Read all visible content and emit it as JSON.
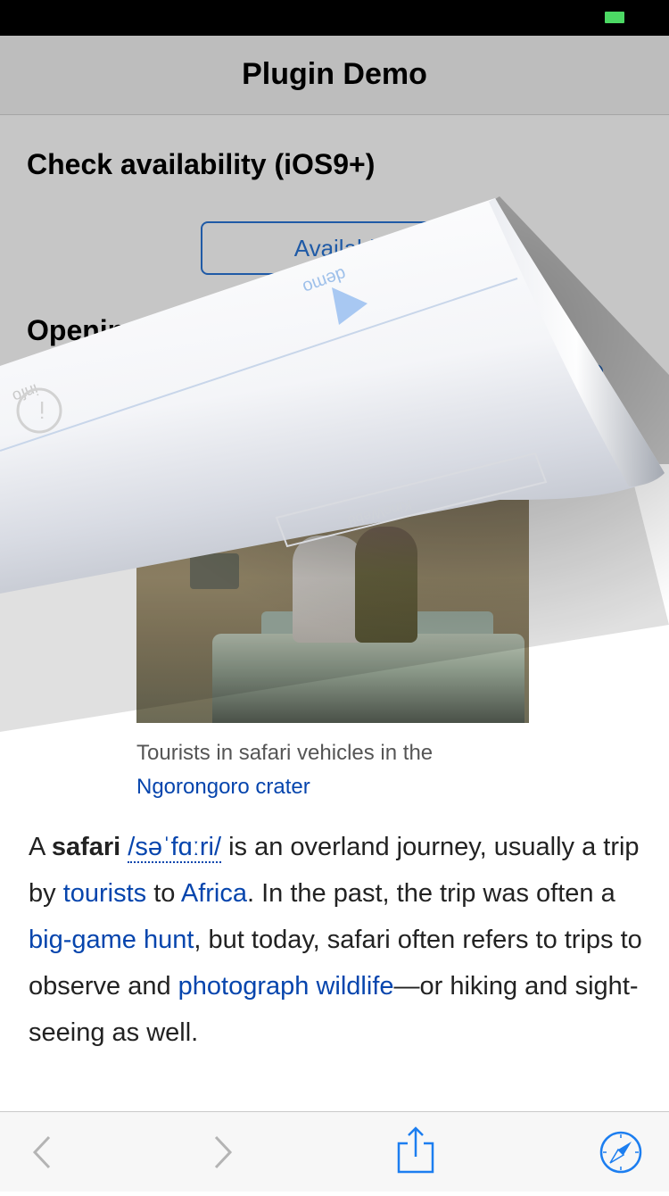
{
  "app": {
    "nav_title": "Plugin Demo",
    "section1_title": "Check availability (iOS9+)",
    "availability_button": "Availabl",
    "section2_title": "Openin",
    "curl_text_demo": "demo",
    "curl_text_info": "info",
    "curl_text_mirrored": "KinoWeb8"
  },
  "article": {
    "caption_prefix": "Tourists in safari vehicles in the",
    "caption_link": "Ngorongoro crater",
    "p_a": "A ",
    "p_safari": "safari",
    "p_ipa": "/səˈfɑːri/",
    "p_t1": " is an overland journey, usually a trip by ",
    "p_tourists": "tourists",
    "p_t2": " to ",
    "p_africa": "Africa",
    "p_t3": ". In the past, the trip was often a ",
    "p_biggame": "big-game hunt",
    "p_t4": ", but today, safari often refers to trips to observe and ",
    "p_photo": "photograph wildlife",
    "p_t5": "—or hiking and sight-seeing as well."
  },
  "toolbar": {
    "back_icon": "chevron-left-icon",
    "forward_icon": "chevron-right-icon",
    "share_icon": "share-icon",
    "safari_icon": "compass-icon"
  },
  "colors": {
    "link": "#0645ad",
    "ios_blue": "#1c7ef0",
    "battery": "#4cd964"
  }
}
